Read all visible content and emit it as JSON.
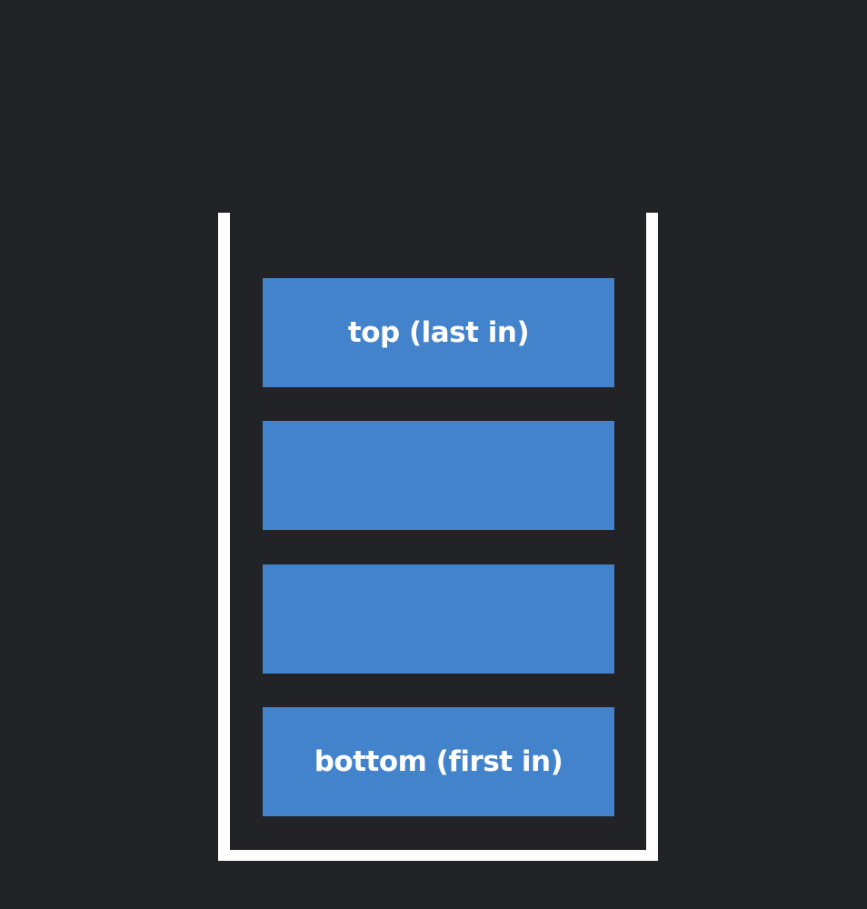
{
  "stack": {
    "items": [
      {
        "label": "top (last in)"
      },
      {
        "label": ""
      },
      {
        "label": ""
      },
      {
        "label": "bottom (first in)"
      }
    ]
  },
  "colors": {
    "background": "#222327",
    "container_border": "#ffffff",
    "item_fill": "#4283cb",
    "item_text": "#ffffff"
  }
}
